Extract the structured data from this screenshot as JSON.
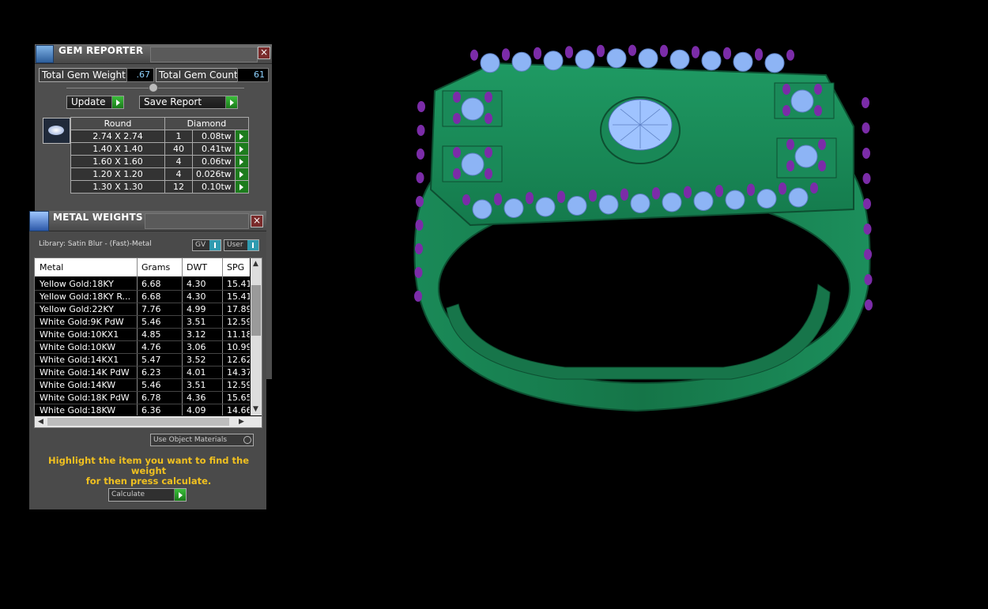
{
  "gem_reporter": {
    "title": "GEM REPORTER",
    "total_weight_label": "Total Gem Weight",
    "total_weight_value": ".67",
    "total_count_label": "Total Gem Count",
    "total_count_value": "61",
    "update_label": "Update",
    "save_report_label": "Save Report",
    "shape_header": "Round",
    "stone_header": "Diamond",
    "rows": [
      {
        "size": "2.74 X 2.74",
        "count": "1",
        "weight": "0.08tw"
      },
      {
        "size": "1.40 X 1.40",
        "count": "40",
        "weight": "0.41tw"
      },
      {
        "size": "1.60 X 1.60",
        "count": "4",
        "weight": "0.06tw"
      },
      {
        "size": "1.20 X 1.20",
        "count": "4",
        "weight": "0.026tw"
      },
      {
        "size": "1.30 X 1.30",
        "count": "12",
        "weight": "0.10tw"
      }
    ]
  },
  "metal_weights": {
    "title": "METAL WEIGHTS",
    "library_label": "Library: Satin Blur - (Fast)-Metal",
    "gv_label": "GV",
    "user_label": "User",
    "columns": [
      "Metal",
      "Grams",
      "DWT",
      "SPG"
    ],
    "rows": [
      {
        "metal": "Yellow Gold:18KY",
        "grams": "6.68",
        "dwt": "4.30",
        "spg": "15.41"
      },
      {
        "metal": "Yellow Gold:18KY R...",
        "grams": "6.68",
        "dwt": "4.30",
        "spg": "15.41"
      },
      {
        "metal": "Yellow Gold:22KY",
        "grams": "7.76",
        "dwt": "4.99",
        "spg": "17.89"
      },
      {
        "metal": "White Gold:9K PdW",
        "grams": "5.46",
        "dwt": "3.51",
        "spg": "12.59"
      },
      {
        "metal": "White Gold:10KX1",
        "grams": "4.85",
        "dwt": "3.12",
        "spg": "11.18"
      },
      {
        "metal": "White Gold:10KW",
        "grams": "4.76",
        "dwt": "3.06",
        "spg": "10.99"
      },
      {
        "metal": "White Gold:14KX1",
        "grams": "5.47",
        "dwt": "3.52",
        "spg": "12.62"
      },
      {
        "metal": "White Gold:14K PdW",
        "grams": "6.23",
        "dwt": "4.01",
        "spg": "14.37"
      },
      {
        "metal": "White Gold:14KW",
        "grams": "5.46",
        "dwt": "3.51",
        "spg": "12.59"
      },
      {
        "metal": "White Gold:18K PdW",
        "grams": "6.78",
        "dwt": "4.36",
        "spg": "15.65"
      },
      {
        "metal": "White Gold:18KW",
        "grams": "6.36",
        "dwt": "4.09",
        "spg": "14.66"
      }
    ],
    "use_object_materials_label": "Use Object Materials",
    "hint_line1": "Highlight the item you want to find the weight",
    "hint_line2": "for then press calculate.",
    "calculate_label": "Calculate"
  },
  "colors": {
    "metal_green": "#1f8a5c",
    "gem_blue": "#8db4f5",
    "prong_purple": "#7b2ca8",
    "hint_yellow": "#f0c020"
  }
}
